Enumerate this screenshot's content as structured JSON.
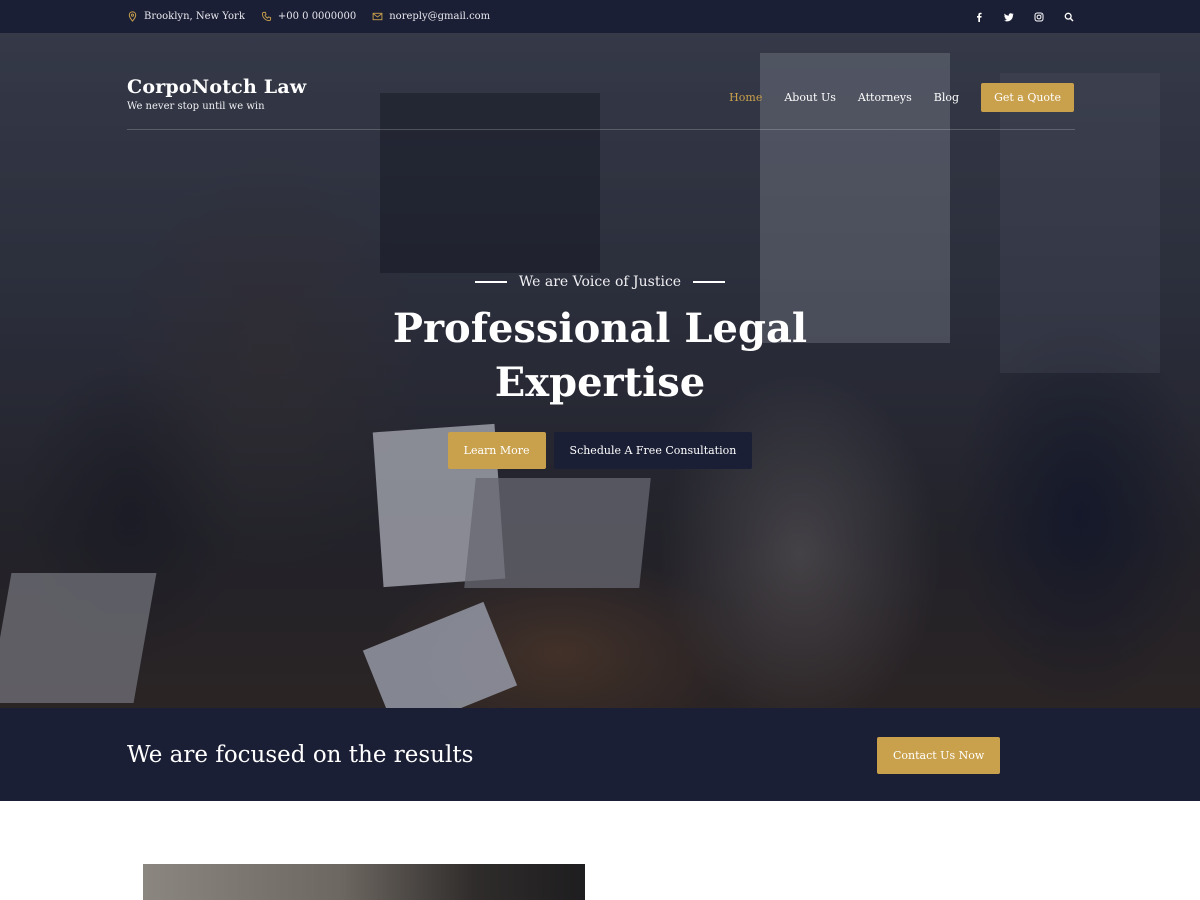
{
  "topbar": {
    "location": "Brooklyn, New York",
    "phone": "+00 0 0000000",
    "email": "noreply@gmail.com",
    "social": [
      "facebook-icon",
      "twitter-icon",
      "instagram-icon",
      "search-icon"
    ]
  },
  "brand": {
    "name": "CorpoNotch Law",
    "tagline": "We never stop until we win"
  },
  "nav": {
    "items": [
      {
        "label": "Home",
        "active": true
      },
      {
        "label": "About Us"
      },
      {
        "label": "Attorneys"
      },
      {
        "label": "Blog"
      }
    ],
    "quote_label": "Get a Quote"
  },
  "hero": {
    "eyebrow": "We are Voice of Justice",
    "title_line1": "Professional Legal",
    "title_line2": "Expertise",
    "learn_more": "Learn More",
    "consult": "Schedule A Free Consultation"
  },
  "band": {
    "heading": "We are focused on the results",
    "contact_label": "Contact Us Now"
  },
  "colors": {
    "navy": "#1b1f35",
    "gold": "#c9a04b"
  }
}
